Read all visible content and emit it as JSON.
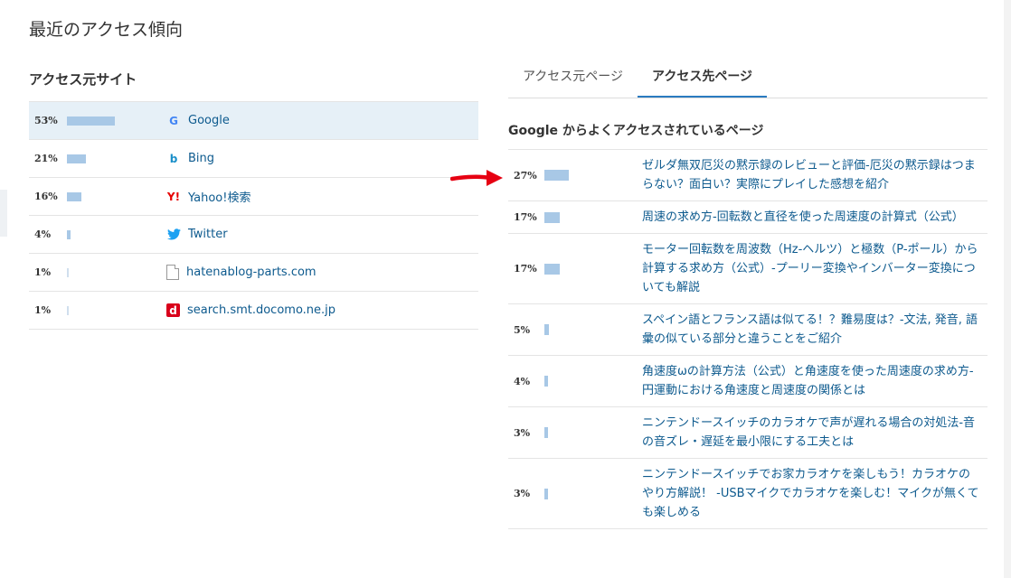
{
  "title": "最近のアクセス傾向",
  "referrers": {
    "heading": "アクセス元サイト",
    "rows": [
      {
        "percent": "53%",
        "value": 53,
        "name": "Google",
        "icon": "google-icon"
      },
      {
        "percent": "21%",
        "value": 21,
        "name": "Bing",
        "icon": "bing-icon"
      },
      {
        "percent": "16%",
        "value": 16,
        "name": "Yahoo!検索",
        "icon": "yahoo-icon"
      },
      {
        "percent": "4%",
        "value": 4,
        "name": "Twitter",
        "icon": "twitter-icon"
      },
      {
        "percent": "1%",
        "value": 1,
        "name": "hatenablog-parts.com",
        "icon": "file-icon"
      },
      {
        "percent": "1%",
        "value": 1,
        "name": "search.smt.docomo.ne.jp",
        "icon": "docomo-icon"
      }
    ]
  },
  "tabs": [
    {
      "label": "アクセス元ページ",
      "active": false
    },
    {
      "label": "アクセス先ページ",
      "active": true
    }
  ],
  "pages": {
    "heading": "Google からよくアクセスされているページ",
    "rows": [
      {
        "percent": "27%",
        "value": 27,
        "title": "ゼルダ無双厄災の黙示録のレビューと評価-厄災の黙示録はつまらない？面白い？実際にプレイした感想を紹介"
      },
      {
        "percent": "17%",
        "value": 17,
        "title": "周速の求め方-回転数と直径を使った周速度の計算式（公式）"
      },
      {
        "percent": "17%",
        "value": 17,
        "title": "モーター回転数を周波数（Hz-ヘルツ）と極数（P-ポール）から計算する求め方（公式）-プーリー変換やインバーター変換についても解説"
      },
      {
        "percent": "5%",
        "value": 5,
        "title": "スペイン語とフランス語は似てる！？難易度は？-文法, 発音, 語彙の似ている部分と違うことをご紹介"
      },
      {
        "percent": "4%",
        "value": 4,
        "title": "角速度ωの計算方法（公式）と角速度を使った周速度の求め方-円運動における角速度と周速度の関係とは"
      },
      {
        "percent": "3%",
        "value": 3,
        "title": "ニンテンドースイッチのカラオケで声が遅れる場合の対処法-音の音ズレ・遅延を最小限にする工夫とは"
      },
      {
        "percent": "3%",
        "value": 3,
        "title": "ニンテンドースイッチでお家カラオケを楽しもう！カラオケのやり方解説！ -USBマイクでカラオケを楽しむ！マイクが無くても楽しめる"
      }
    ]
  },
  "colors": {
    "bar": "#a8c8e6",
    "link": "#0d5a8e",
    "selected_row": "#e6f0f7",
    "tab_underline": "#2a7bc0",
    "arrow": "#e60012"
  }
}
